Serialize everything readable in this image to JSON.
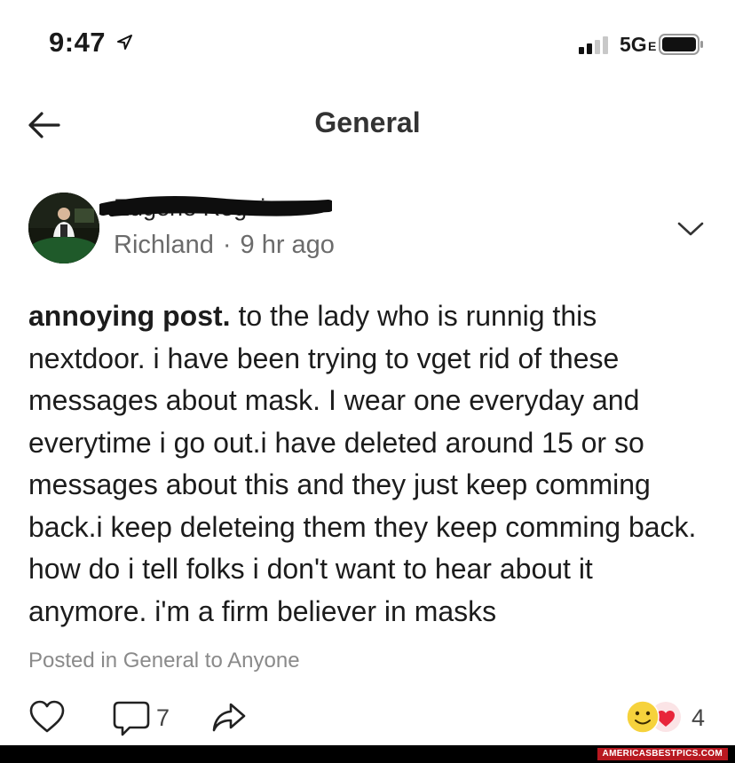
{
  "status_bar": {
    "time": "9:47",
    "network": "5G",
    "network_suffix": "E"
  },
  "nav": {
    "title": "General"
  },
  "post": {
    "author": "Eugene Regnier",
    "neighborhood": "Richland",
    "separator": "·",
    "time_ago": "9 hr ago",
    "subject": "annoying post.",
    "body": " to the lady who is runnig this nextdoor. i have been trying to vget rid of these messages about mask. I wear one everyday and everytime i go out.i have deleted around 15 or so messages about this and they just keep comming back.i keep deleteing them they keep comming back. how do i tell folks i don't want to hear about it anymore. i'm a firm believer in masks",
    "posted_in": "Posted in General to Anyone",
    "comment_count": "7",
    "reaction_count": "4"
  },
  "icons": {
    "back": "back-arrow-icon",
    "options": "chevron-down-icon",
    "like": "heart-icon",
    "comment": "comment-icon",
    "share": "share-icon",
    "reactions": "smiley-heart-reactions"
  },
  "colors": {
    "text": "#1c1c1c",
    "meta": "#6b6b6b",
    "posted_in": "#8a8a8a",
    "heart_reaction": "#e8253a",
    "smiley": "#f6d23c"
  },
  "watermark": "AMERICASBESTPICS.COM"
}
